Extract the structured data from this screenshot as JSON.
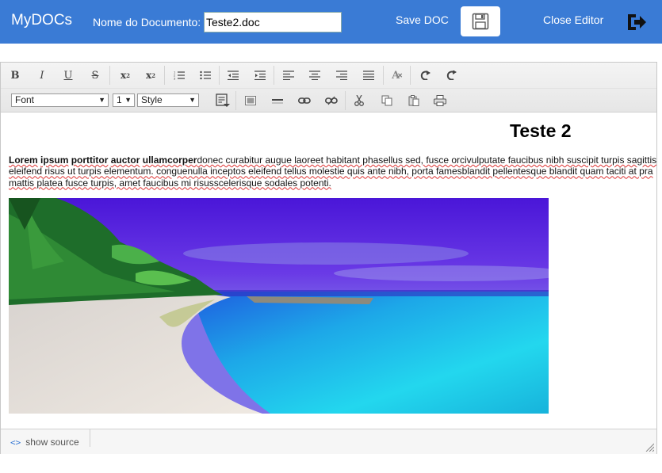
{
  "header": {
    "brand": "MyDOCs",
    "doc_label": "Nome do Documento:",
    "doc_name": "Teste2.doc",
    "save_label": "Save DOC",
    "close_label": "Close Editor"
  },
  "toolbar": {
    "font_select": "Font",
    "size_select": "1",
    "style_select": "Style",
    "buttons_row1": [
      "bold-icon",
      "italic-icon",
      "underline-icon",
      "strikethrough-icon",
      "subscript-icon",
      "superscript-icon",
      "ordered-list-icon",
      "unordered-list-icon",
      "outdent-icon",
      "indent-icon",
      "align-left-icon",
      "align-center-icon",
      "align-right-icon",
      "align-justify-icon",
      "remove-format-icon",
      "undo-icon",
      "redo-icon"
    ],
    "buttons_row2": [
      "insert-block-icon",
      "image-icon",
      "horizontal-rule-icon",
      "link-icon",
      "unlink-icon",
      "cut-icon",
      "copy-icon",
      "paste-icon",
      "print-icon"
    ]
  },
  "content": {
    "heading": "Teste 2",
    "para_bold_1": "Lorem",
    "para_bold_2": "ipsum",
    "para_bold_3": "porttitor",
    "para_bold_4": "auctor",
    "para_bold_5": "ullamcorper",
    "para_rest": "donec curabitur augue laoreet habitant phasellus sed, fusce orcivulputate faucibus nibh suscipit turpis sagittis eleifend risus ut turpis elementum. conguenulla inceptos eleifend tellus molestie quis ante nibh, porta famesblandit pellentesque blandit quam taciti at pra mattis platea fusce turpis, amet faucibus mi risusscelerisque sodales potenti."
  },
  "status": {
    "show_source": "show source",
    "code_glyph": "<>"
  },
  "colors": {
    "header_bg": "#3a7bd5",
    "accent": "#3a7bd5"
  }
}
